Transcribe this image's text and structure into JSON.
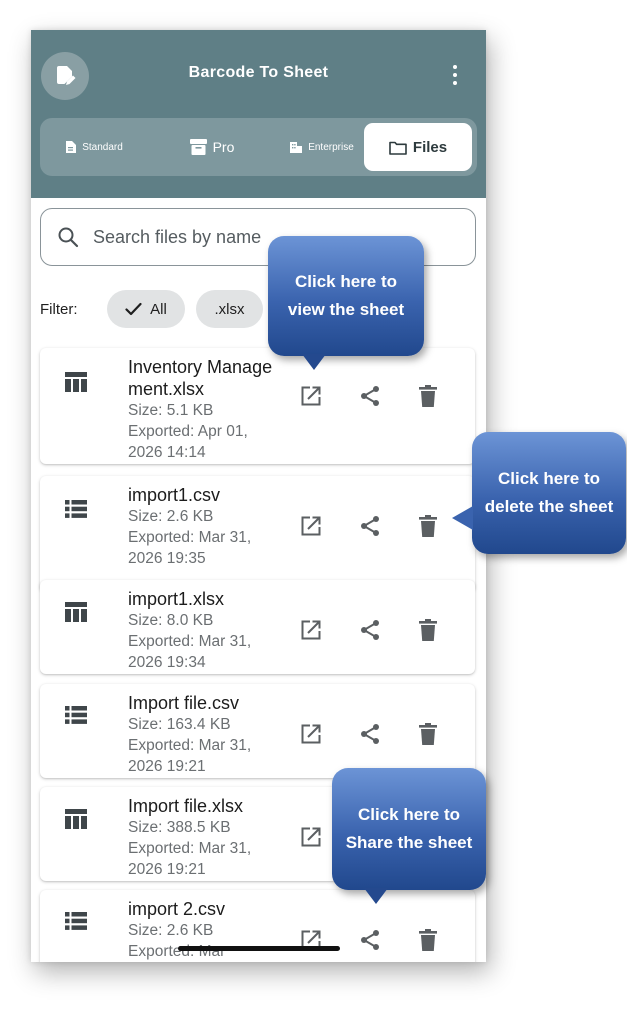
{
  "app": {
    "title": "Barcode To Sheet",
    "logo_icon": "document-edit-icon",
    "menu_icon": "more-vertical-icon"
  },
  "tabs": [
    {
      "label": "Standard",
      "icon": "file-icon",
      "active": false
    },
    {
      "label": "Pro",
      "icon": "archive-icon",
      "active": false
    },
    {
      "label": "Enterprise",
      "icon": "building-icon",
      "active": false
    },
    {
      "label": "Files",
      "icon": "folder-icon",
      "active": true
    }
  ],
  "search": {
    "placeholder": "Search files by name",
    "icon": "search-icon"
  },
  "filter": {
    "label": "Filter:",
    "chips": [
      {
        "label": "All",
        "selected": true,
        "icon": "check-icon"
      },
      {
        "label": ".xlsx",
        "selected": false
      }
    ]
  },
  "files": [
    {
      "name": "Inventory Management.xlsx",
      "size": "Size: 5.1 KB",
      "exported": "Exported: Apr 01, 2026 14:14",
      "type": "table-icon"
    },
    {
      "name": "import1.csv",
      "size": "Size: 2.6 KB",
      "exported": "Exported: Mar 31, 2026 19:35",
      "type": "list-icon"
    },
    {
      "name": "import1.xlsx",
      "size": "Size: 8.0 KB",
      "exported": "Exported: Mar 31, 2026 19:34",
      "type": "table-icon"
    },
    {
      "name": "Import file.csv",
      "size": "Size: 163.4 KB",
      "exported": "Exported: Mar 31, 2026 19:21",
      "type": "list-icon"
    },
    {
      "name": "Import file.xlsx",
      "size": "Size: 388.5 KB",
      "exported": "Exported: Mar 31, 2026 19:21",
      "type": "table-icon"
    },
    {
      "name": "import 2.csv",
      "size": "Size: 2.6 KB",
      "exported": "Exported: Mar",
      "type": "list-icon"
    }
  ],
  "actions": {
    "open_icon": "open-external-icon",
    "share_icon": "share-icon",
    "delete_icon": "trash-icon"
  },
  "callouts": {
    "view": "Click here to view the sheet",
    "delete": "Click here to delete the sheet",
    "share": "Click here to Share the sheet"
  },
  "colors": {
    "header": "#5f7f86",
    "callout": "#3a63ae"
  }
}
